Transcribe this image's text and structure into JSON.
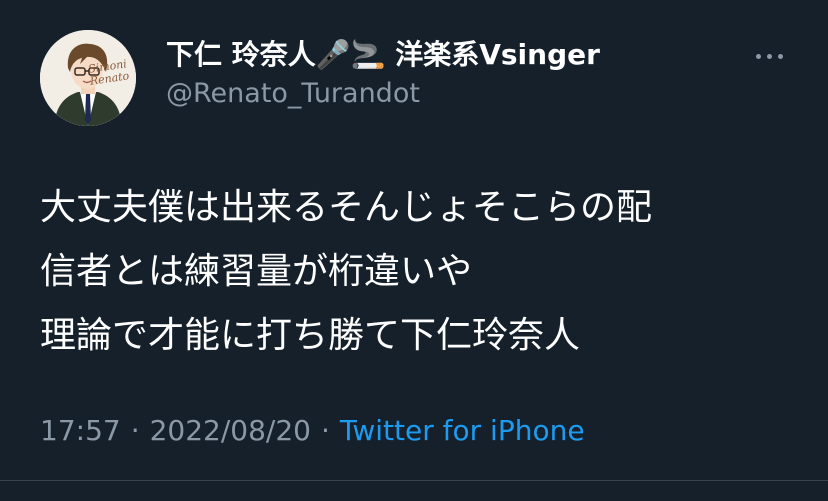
{
  "tweet": {
    "display_name": "下仁 玲奈人🎤🚬 洋楽系Vsinger",
    "handle": "@Renato_Turandot",
    "avatar_text": [
      "Simoni",
      "Renato"
    ],
    "text_lines": [
      "大丈夫僕は出来るそんじょそこらの配",
      "信者とは練習量が桁違いや",
      "理論で才能に打ち勝て下仁玲奈人"
    ],
    "time": "17:57",
    "separator": "·",
    "date": "2022/08/20",
    "source": "Twitter for iPhone"
  },
  "colors": {
    "background": "#15202b",
    "text": "#ffffff",
    "secondary": "#8b98a5",
    "link": "#1d9bf0"
  },
  "icons": {
    "more": "more-horizontal-icon"
  }
}
